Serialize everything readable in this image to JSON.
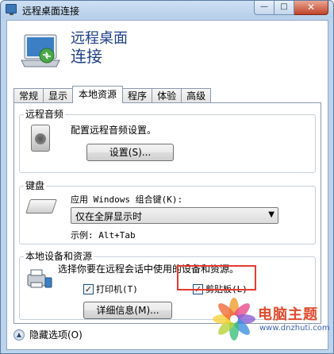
{
  "window": {
    "title": "远程桌面连接",
    "controls": {
      "minimize": "—",
      "maximize": "□",
      "close": "✕"
    }
  },
  "header": {
    "title_line1": "远程桌面",
    "title_line2": "连接"
  },
  "tabs": [
    {
      "label": "常规",
      "active": false
    },
    {
      "label": "显示",
      "active": false
    },
    {
      "label": "本地资源",
      "active": true
    },
    {
      "label": "程序",
      "active": false
    },
    {
      "label": "体验",
      "active": false
    },
    {
      "label": "高级",
      "active": false
    }
  ],
  "audio": {
    "group_label": "远程音频",
    "description": "配置远程音频设置。",
    "settings_button": "设置(S)..."
  },
  "keyboard": {
    "group_label": "键盘",
    "prompt": "应用 Windows 组合键(K):",
    "selected": "仅在全屏显示时",
    "example": "示例: Alt+Tab"
  },
  "local_devices": {
    "group_label": "本地设备和资源",
    "description": "选择你要在远程会话中使用的设备和资源。",
    "printer": {
      "label": "打印机(T)",
      "checked": true
    },
    "clipboard": {
      "label": "剪贴板(L)",
      "checked": true
    },
    "details_button": "详细信息(M)..."
  },
  "footer": {
    "toggle_label": "隐藏选项(O)"
  },
  "watermark": {
    "title": "电脑主题",
    "url": "www.dnzhuti.com"
  },
  "colors": {
    "highlight": "#e83a2e",
    "header_text": "#1e3f8a",
    "frame": "#bcd3ec"
  }
}
